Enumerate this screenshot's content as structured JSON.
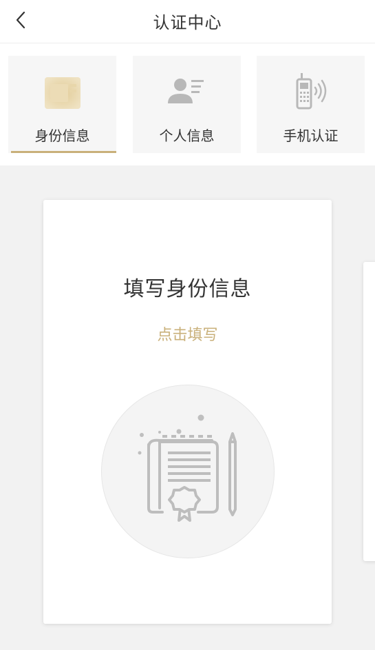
{
  "header": {
    "title": "认证中心",
    "back_icon": "chevron-left-icon"
  },
  "tabs": [
    {
      "label": "身份信息",
      "icon": "id-card-icon",
      "active": true
    },
    {
      "label": "个人信息",
      "icon": "person-info-icon",
      "active": false
    },
    {
      "label": "手机认证",
      "icon": "phone-signal-icon",
      "active": false
    }
  ],
  "card": {
    "title": "填写身份信息",
    "action_label": "点击填写",
    "illustration": "certificate-document-icon"
  },
  "colors": {
    "accent": "#c9b07a",
    "background": "#f2f2f2",
    "icon_gray": "#b8b8b8"
  }
}
